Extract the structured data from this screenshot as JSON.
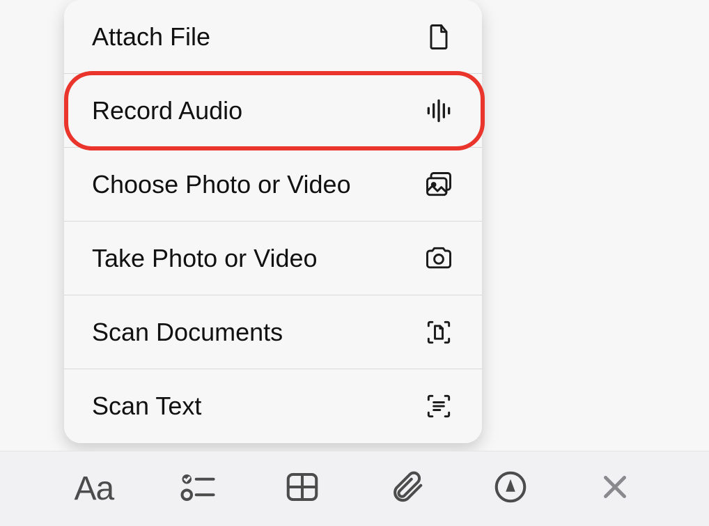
{
  "menu": {
    "items": [
      {
        "label": "Attach File",
        "icon": "file-icon"
      },
      {
        "label": "Record Audio",
        "icon": "waveform-icon"
      },
      {
        "label": "Choose Photo or Video",
        "icon": "gallery-icon"
      },
      {
        "label": "Take Photo or Video",
        "icon": "camera-icon"
      },
      {
        "label": "Scan Documents",
        "icon": "scan-doc-icon"
      },
      {
        "label": "Scan Text",
        "icon": "scan-text-icon"
      }
    ],
    "highlighted_index": 1
  },
  "toolbar": {
    "items": [
      {
        "name": "text-format",
        "icon": "aa-icon"
      },
      {
        "name": "checklist",
        "icon": "checklist-icon"
      },
      {
        "name": "table",
        "icon": "table-icon"
      },
      {
        "name": "attach",
        "icon": "paperclip-icon"
      },
      {
        "name": "markup",
        "icon": "markup-icon"
      },
      {
        "name": "close",
        "icon": "close-icon"
      }
    ]
  }
}
